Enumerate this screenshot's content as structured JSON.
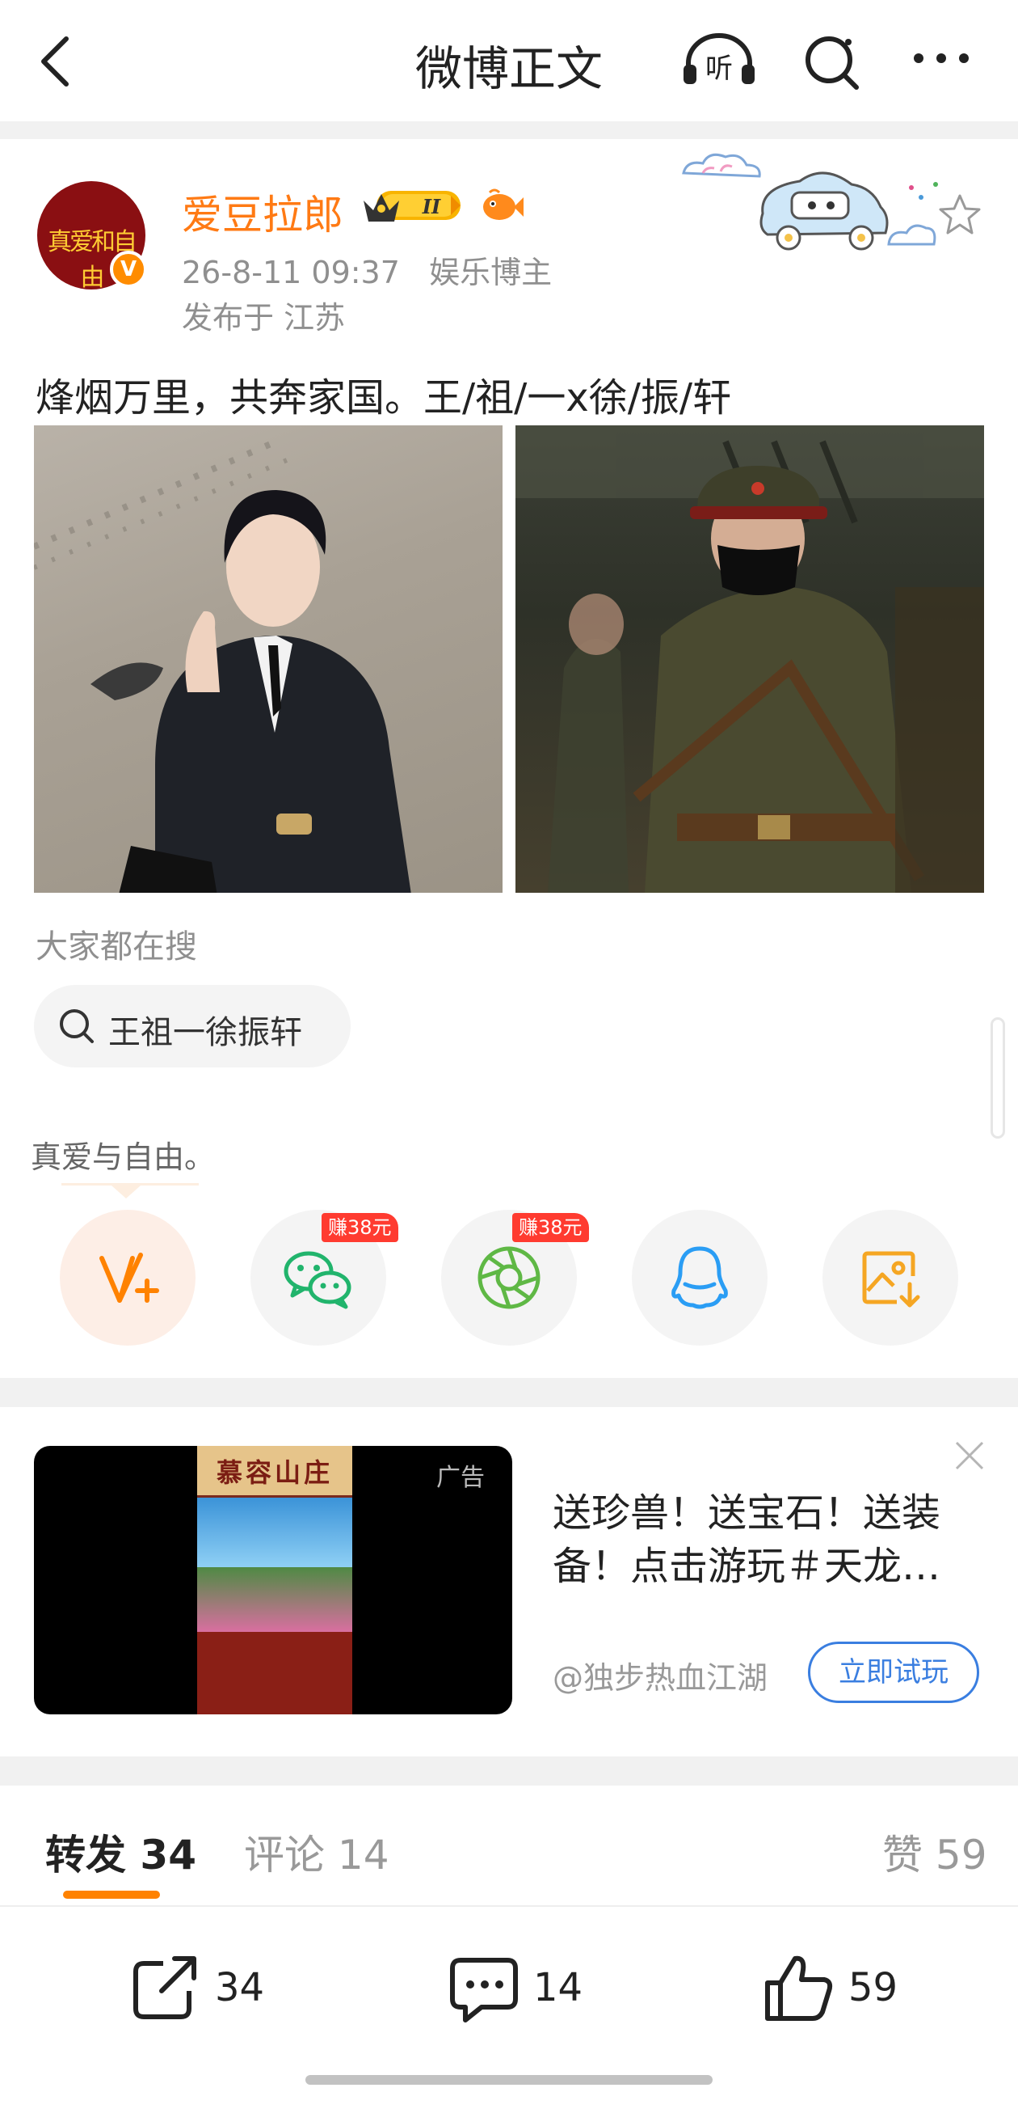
{
  "header": {
    "title": "微博正文",
    "icons": [
      "back-icon",
      "listen-icon",
      "search-icon",
      "more-icon"
    ]
  },
  "post": {
    "author": "爱豆拉郎",
    "avatar_text": "真爱和自由",
    "meta": "26-8-11 09:37   娱乐博主",
    "location": "发布于 江苏",
    "content": "烽烟万里，共奔家国。王/祖/一x徐/振/轩"
  },
  "hot_search": {
    "label": "大家都在搜",
    "query": "王祖一徐振轩"
  },
  "share": {
    "tooltip": "真爱与自由。",
    "reward_1": "赚38元",
    "reward_2": "赚38元",
    "icons": [
      "weibo-repost-icon",
      "wechat-icon",
      "moments-icon",
      "qq-icon",
      "save-image-icon"
    ]
  },
  "ad": {
    "tag": "广告",
    "poster_title": "慕容山庄",
    "text": "送珍兽！送宝石！送装备！点击游玩＃天龙…",
    "source": "@独步热血江湖",
    "cta": "立即试玩"
  },
  "tabs": {
    "repost": "转发 34",
    "comments": "评论 14",
    "likes": "赞 59"
  },
  "bottom_bar": {
    "repost_count": "34",
    "comment_count": "14",
    "like_count": "59"
  },
  "colors": {
    "accent": "#ff8200",
    "username": "#ff7a14",
    "link": "#3a7ee0",
    "reward": "#ff3b30"
  }
}
